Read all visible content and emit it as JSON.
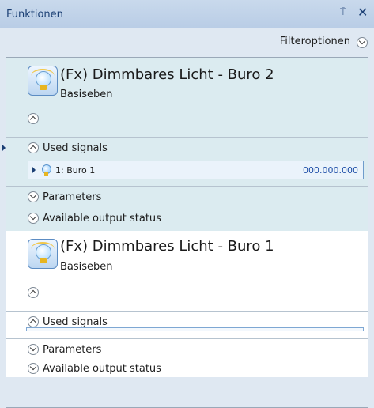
{
  "window": {
    "title": "Funktionen",
    "pin_glyph": "⍑",
    "close_glyph": "✕"
  },
  "toolbar": {
    "filter_label": "Filteroptionen"
  },
  "functions": [
    {
      "title": "(Fx) Dimmbares Licht - Buro 2",
      "subtitle": "Basiseben",
      "used_signals_label": "Used signals",
      "parameters_label": "Parameters",
      "output_status_label": "Available output status",
      "signals": [
        {
          "name": "1: Buro 1",
          "address": "000.000.000"
        }
      ]
    },
    {
      "title": "(Fx) Dimmbares Licht - Buro 1",
      "subtitle": "Basiseben",
      "used_signals_label": "Used signals",
      "parameters_label": "Parameters",
      "output_status_label": "Available output status"
    }
  ],
  "colors": {
    "selected_bg": "#dbebf0",
    "accent": "#1f4fa8",
    "title_bar": "#c9d9ec"
  },
  "icons": [
    "pin-icon",
    "close-icon",
    "chevron-down-icon",
    "chevron-up-icon",
    "light-bulb-icon"
  ]
}
